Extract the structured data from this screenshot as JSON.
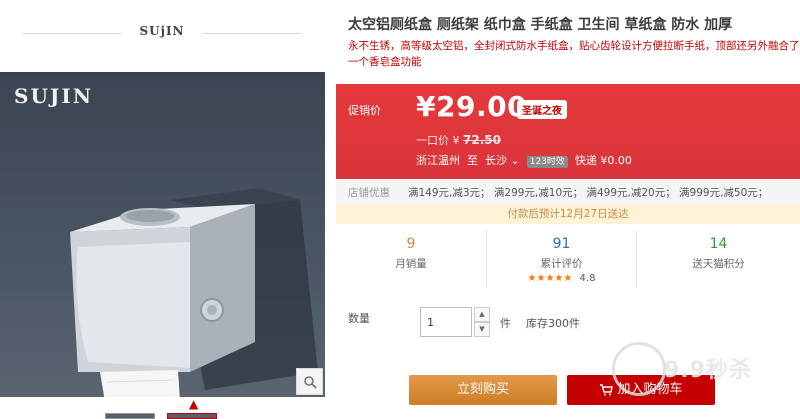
{
  "brand": {
    "name": "SUjIN",
    "image_watermark": "SUJIN"
  },
  "product": {
    "title": "太空铝厕纸盒 厕纸架 纸巾盒 手纸盒 卫生间 草纸盒 防水 加厚",
    "subtitle": "永不生锈，高等级太空铝，全封闭式防水手纸盒，贴心齿轮设计方便拉断手纸，顶部还另外融合了一个香皂盒功能"
  },
  "promo": {
    "label": "促销价",
    "price": "¥29.00",
    "tag": "圣诞之夜",
    "orig_label": "一口价 ¥",
    "orig_price": "72.50",
    "ship_from": "浙江温州",
    "ship_to_word": "至",
    "ship_to": "长沙",
    "hours": "123时效",
    "fee": "快递 ¥0.00"
  },
  "coupons": {
    "label": "店铺优惠",
    "items": "满149元,减3元； 满299元,减10元； 满499元,减20元； 满999元,减50元；"
  },
  "delivery": "付款后预计12月27日送达",
  "stats": [
    {
      "value": "9",
      "label": "月销量"
    },
    {
      "value": "91",
      "label": "累计评价"
    },
    {
      "value": "14",
      "label": "送天猫积分"
    }
  ],
  "rating": {
    "stars": "★★★★★",
    "score": "4.8"
  },
  "quantity": {
    "label": "数量",
    "value": "1",
    "unit": "件",
    "stock": "库存300件"
  },
  "actions": {
    "buy_now": "立刻购买",
    "add_cart": "加入购物车"
  },
  "watermark": "9.9秒杀",
  "colors": {
    "accent": "#c40000",
    "promo_bg": "#e4393c",
    "buy_btn": "#d98b2e",
    "rating": "#ff7a00",
    "stat_sales": "#c88a4a",
    "stat_reviews": "#2a6fb6",
    "stat_points": "#2e9a3f"
  }
}
